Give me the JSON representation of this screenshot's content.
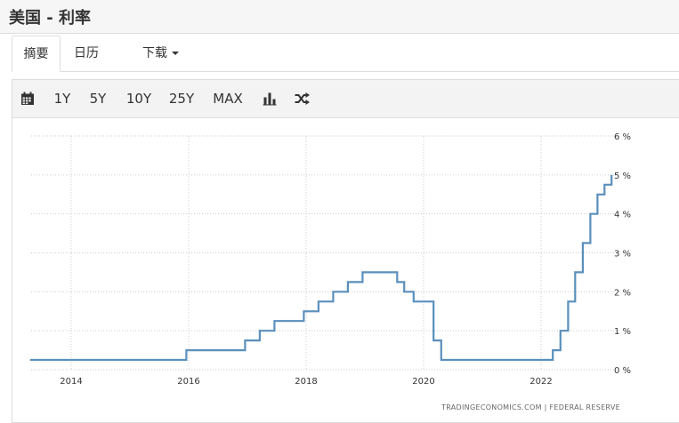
{
  "header": {
    "title": "美国 - 利率"
  },
  "tabs": [
    {
      "label": "摘要",
      "active": true
    },
    {
      "label": "日历"
    },
    {
      "label": "下载"
    }
  ],
  "toolbar": {
    "calendar_icon": "calendar-icon",
    "ranges": [
      "1Y",
      "5Y",
      "10Y",
      "25Y",
      "MAX"
    ],
    "bar_chart_icon": "bar-chart-icon",
    "compare_icon": "shuffle-icon"
  },
  "colors": {
    "line": "#5a8fbc",
    "grid": "#cccccc",
    "toolbar_bg": "#f3f3f3"
  },
  "chart_data": {
    "type": "line",
    "step": true,
    "source": "TRADINGECONOMICS.COM  |  FEDERAL RESERVE",
    "x_ticks": [
      "2014",
      "2016",
      "2018",
      "2020",
      "2022"
    ],
    "y_ticks": [
      "0 %",
      "1 %",
      "2 %",
      "3 %",
      "4 %",
      "5 %",
      "6 %"
    ],
    "xlim": [
      2013.3,
      2023.1
    ],
    "ylim": [
      0,
      6
    ],
    "grid": true,
    "series": [
      {
        "values": [
          {
            "x": 2013.3,
            "y": 0.25
          },
          {
            "x": 2015.96,
            "y": 0.5
          },
          {
            "x": 2016.96,
            "y": 0.75
          },
          {
            "x": 2017.21,
            "y": 1.0
          },
          {
            "x": 2017.46,
            "y": 1.25
          },
          {
            "x": 2017.96,
            "y": 1.5
          },
          {
            "x": 2018.21,
            "y": 1.75
          },
          {
            "x": 2018.46,
            "y": 2.0
          },
          {
            "x": 2018.71,
            "y": 2.25
          },
          {
            "x": 2018.96,
            "y": 2.5
          },
          {
            "x": 2019.55,
            "y": 2.25
          },
          {
            "x": 2019.67,
            "y": 2.0
          },
          {
            "x": 2019.83,
            "y": 1.75
          },
          {
            "x": 2020.17,
            "y": 0.75
          },
          {
            "x": 2020.3,
            "y": 0.25
          },
          {
            "x": 2022.2,
            "y": 0.5
          },
          {
            "x": 2022.33,
            "y": 1.0
          },
          {
            "x": 2022.46,
            "y": 1.75
          },
          {
            "x": 2022.58,
            "y": 2.5
          },
          {
            "x": 2022.71,
            "y": 3.25
          },
          {
            "x": 2022.84,
            "y": 4.0
          },
          {
            "x": 2022.96,
            "y": 4.5
          },
          {
            "x": 2023.08,
            "y": 4.75
          },
          {
            "x": 2023.2,
            "y": 5.0
          }
        ]
      }
    ]
  }
}
